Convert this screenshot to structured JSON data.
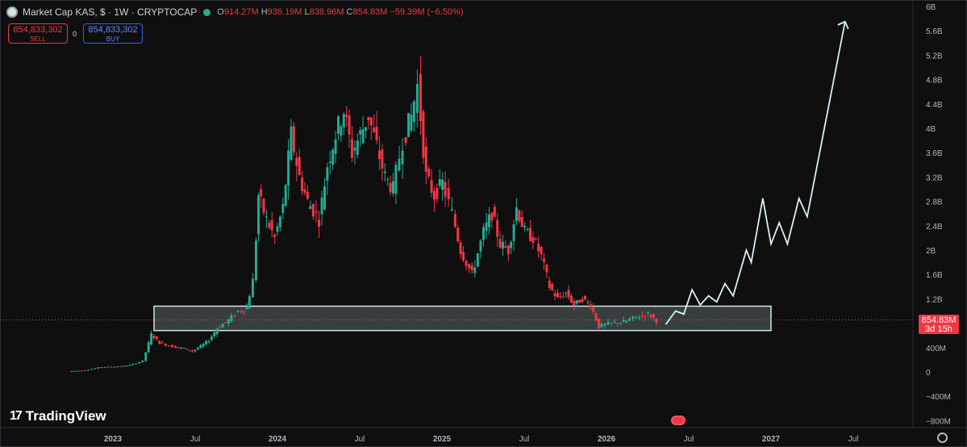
{
  "header": {
    "symbol_title": "Market Cap KAS, $ · 1W · CRYPTOCAP",
    "open_label": "O",
    "open": "914.27M",
    "high_label": "H",
    "high": "936.19M",
    "low_label": "L",
    "low": "838.96M",
    "close_label": "C",
    "close": "854.83M",
    "change": "−59.39M (−6.50%)"
  },
  "trade": {
    "sell_price": "854,833,302",
    "sell_label": "SELL",
    "spread": "0",
    "buy_price": "854,833,302",
    "buy_label": "BUY"
  },
  "price_tag": {
    "value": "854.83M",
    "countdown": "3d 15h"
  },
  "branding": {
    "logo_text": "TradingView",
    "logo_mark": "17"
  },
  "colors": {
    "up": "#22ab94",
    "down": "#f23645",
    "projection": "#d4f1f9",
    "zone": "#cfe8ec",
    "axis_text": "#b2b5be"
  },
  "chart_data": {
    "type": "candlestick",
    "timeframe": "1W",
    "y_axis": {
      "unit": "market cap ($)",
      "ylim": [
        -850000000,
        6000000000
      ],
      "tick_labels": [
        "6B",
        "5.6B",
        "5.2B",
        "4.8B",
        "4.4B",
        "4B",
        "3.6B",
        "3.2B",
        "2.8B",
        "2.4B",
        "2B",
        "1.6B",
        "1.2B",
        "800M",
        "400M",
        "0",
        "−400M",
        "−800M"
      ],
      "tick_values": [
        6.0,
        5.6,
        5.2,
        4.8,
        4.4,
        4.0,
        3.6,
        3.2,
        2.8,
        2.4,
        2.0,
        1.6,
        1.2,
        0.8,
        0.4,
        0,
        -0.4,
        -0.8
      ]
    },
    "x_axis": {
      "tick_labels": [
        "2023",
        "Jul",
        "2024",
        "Jul",
        "2025",
        "Jul",
        "2026",
        "Jul",
        "2027",
        "Jul"
      ],
      "tick_dates": [
        2023.0,
        2023.5,
        2024.0,
        2024.5,
        2025.0,
        2025.5,
        2026.0,
        2026.5,
        2027.0,
        2027.5
      ]
    },
    "support_zone": {
      "from_date": 2023.25,
      "to_date": 2027.0,
      "low": 0.68,
      "high": 1.08
    },
    "current_price": 0.85483,
    "price_series_approx": [
      [
        2022.75,
        0.01
      ],
      [
        2022.85,
        0.03
      ],
      [
        2022.95,
        0.08
      ],
      [
        2023.05,
        0.09
      ],
      [
        2023.12,
        0.11
      ],
      [
        2023.2,
        0.18
      ],
      [
        2023.25,
        0.62
      ],
      [
        2023.3,
        0.48
      ],
      [
        2023.38,
        0.42
      ],
      [
        2023.45,
        0.38
      ],
      [
        2023.5,
        0.34
      ],
      [
        2023.55,
        0.42
      ],
      [
        2023.6,
        0.52
      ],
      [
        2023.65,
        0.72
      ],
      [
        2023.72,
        0.85
      ],
      [
        2023.78,
        1.0
      ],
      [
        2023.83,
        1.05
      ],
      [
        2023.87,
        1.5
      ],
      [
        2023.9,
        2.9
      ],
      [
        2023.95,
        2.5
      ],
      [
        2024.0,
        2.2
      ],
      [
        2024.05,
        2.7
      ],
      [
        2024.1,
        3.9
      ],
      [
        2024.15,
        3.2
      ],
      [
        2024.2,
        2.8
      ],
      [
        2024.27,
        2.5
      ],
      [
        2024.32,
        3.4
      ],
      [
        2024.37,
        3.9
      ],
      [
        2024.42,
        4.3
      ],
      [
        2024.47,
        3.6
      ],
      [
        2024.52,
        3.9
      ],
      [
        2024.57,
        4.2
      ],
      [
        2024.62,
        3.7
      ],
      [
        2024.67,
        3.2
      ],
      [
        2024.72,
        3.0
      ],
      [
        2024.78,
        3.8
      ],
      [
        2024.83,
        4.2
      ],
      [
        2024.87,
        4.7
      ],
      [
        2024.92,
        3.2
      ],
      [
        2024.97,
        2.9
      ],
      [
        2025.02,
        3.1
      ],
      [
        2025.08,
        2.6
      ],
      [
        2025.13,
        2.0
      ],
      [
        2025.2,
        1.6
      ],
      [
        2025.27,
        2.3
      ],
      [
        2025.32,
        2.6
      ],
      [
        2025.37,
        2.1
      ],
      [
        2025.42,
        2.0
      ],
      [
        2025.47,
        2.7
      ],
      [
        2025.52,
        2.3
      ],
      [
        2025.57,
        2.2
      ],
      [
        2025.62,
        1.9
      ],
      [
        2025.67,
        1.4
      ],
      [
        2025.72,
        1.2
      ],
      [
        2025.77,
        1.3
      ],
      [
        2025.82,
        1.1
      ],
      [
        2025.87,
        1.2
      ],
      [
        2025.92,
        1.1
      ],
      [
        2025.97,
        0.75
      ],
      [
        2026.05,
        0.8
      ],
      [
        2026.12,
        0.82
      ],
      [
        2026.2,
        0.9
      ],
      [
        2026.27,
        0.95
      ],
      [
        2026.32,
        0.85
      ]
    ],
    "projection_path": [
      [
        2026.36,
        0.78
      ],
      [
        2026.42,
        1.0
      ],
      [
        2026.47,
        0.95
      ],
      [
        2026.52,
        1.35
      ],
      [
        2026.57,
        1.1
      ],
      [
        2026.62,
        1.25
      ],
      [
        2026.67,
        1.15
      ],
      [
        2026.72,
        1.45
      ],
      [
        2026.77,
        1.25
      ],
      [
        2026.85,
        2.0
      ],
      [
        2026.88,
        1.8
      ],
      [
        2026.95,
        2.85
      ],
      [
        2027.0,
        2.1
      ],
      [
        2027.05,
        2.45
      ],
      [
        2027.1,
        2.1
      ],
      [
        2027.17,
        2.85
      ],
      [
        2027.22,
        2.55
      ],
      [
        2027.45,
        5.75
      ]
    ]
  }
}
